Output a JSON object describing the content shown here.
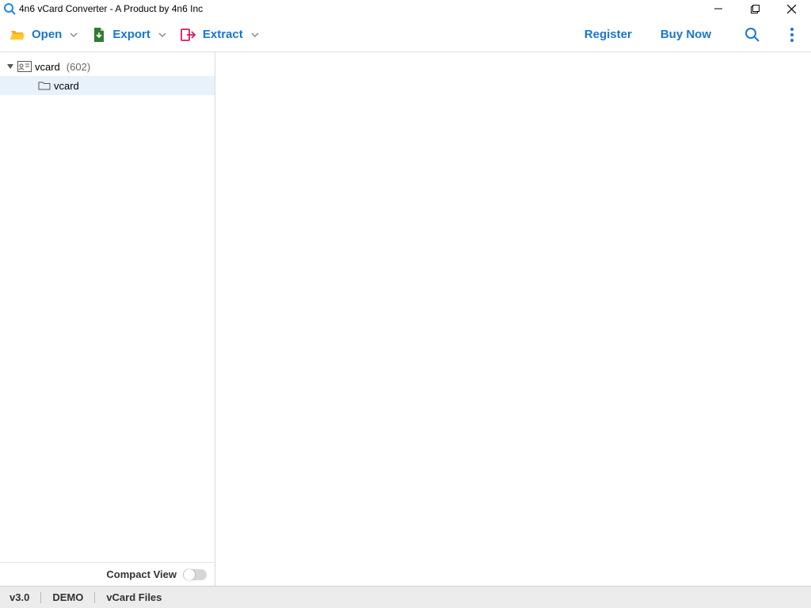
{
  "window": {
    "title": "4n6 vCard Converter - A Product by 4n6 Inc"
  },
  "toolbar": {
    "open_label": "Open",
    "export_label": "Export",
    "extract_label": "Extract",
    "register_label": "Register",
    "buynow_label": "Buy Now"
  },
  "tree": {
    "root": {
      "label": "vcard",
      "count": "(602)"
    },
    "child": {
      "label": "vcard"
    }
  },
  "sidebar": {
    "compact_label": "Compact View"
  },
  "status": {
    "version": "v3.0",
    "mode": "DEMO",
    "filetype": "vCard Files"
  }
}
